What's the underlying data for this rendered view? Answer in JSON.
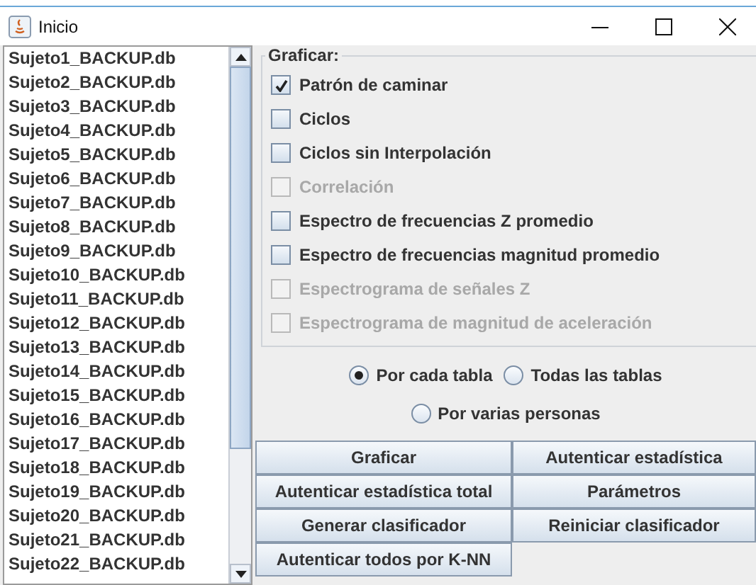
{
  "window": {
    "title": "Inicio"
  },
  "files": [
    {
      "name": "Sujeto1_BACKUP.db"
    },
    {
      "name": "Sujeto2_BACKUP.db"
    },
    {
      "name": "Sujeto3_BACKUP.db"
    },
    {
      "name": "Sujeto4_BACKUP.db"
    },
    {
      "name": "Sujeto5_BACKUP.db"
    },
    {
      "name": "Sujeto6_BACKUP.db"
    },
    {
      "name": "Sujeto7_BACKUP.db"
    },
    {
      "name": "Sujeto8_BACKUP.db"
    },
    {
      "name": "Sujeto9_BACKUP.db"
    },
    {
      "name": "Sujeto10_BACKUP.db"
    },
    {
      "name": "Sujeto11_BACKUP.db"
    },
    {
      "name": "Sujeto12_BACKUP.db"
    },
    {
      "name": "Sujeto13_BACKUP.db"
    },
    {
      "name": "Sujeto14_BACKUP.db"
    },
    {
      "name": "Sujeto15_BACKUP.db"
    },
    {
      "name": "Sujeto16_BACKUP.db"
    },
    {
      "name": "Sujeto17_BACKUP.db"
    },
    {
      "name": "Sujeto18_BACKUP.db"
    },
    {
      "name": "Sujeto19_BACKUP.db"
    },
    {
      "name": "Sujeto20_BACKUP.db"
    },
    {
      "name": "Sujeto21_BACKUP.db"
    },
    {
      "name": "Sujeto22_BACKUP.db"
    }
  ],
  "plot_group": {
    "title": "Graficar:",
    "options": [
      {
        "label": "Patrón de caminar",
        "checked": true,
        "disabled": false
      },
      {
        "label": "Ciclos",
        "checked": false,
        "disabled": false
      },
      {
        "label": "Ciclos sin Interpolación",
        "checked": false,
        "disabled": false
      },
      {
        "label": "Correlación",
        "checked": false,
        "disabled": true
      },
      {
        "label": "Espectro de frecuencias Z promedio",
        "checked": false,
        "disabled": false
      },
      {
        "label": "Espectro de frecuencias magnitud promedio",
        "checked": false,
        "disabled": false
      },
      {
        "label": "Espectrograma de señales Z",
        "checked": false,
        "disabled": true
      },
      {
        "label": "Espectrograma de magnitud de aceleración",
        "checked": false,
        "disabled": true
      }
    ]
  },
  "modes": [
    {
      "label": "Por cada tabla",
      "selected": true
    },
    {
      "label": "Todas las tablas",
      "selected": false
    },
    {
      "label": "Por varias personas",
      "selected": false
    }
  ],
  "buttons": [
    "Graficar",
    "Autenticar estadística",
    "Autenticar estadística total",
    "Parámetros",
    "Generar clasificador",
    "Reiniciar clasificador",
    "Autenticar todos por K-NN"
  ]
}
